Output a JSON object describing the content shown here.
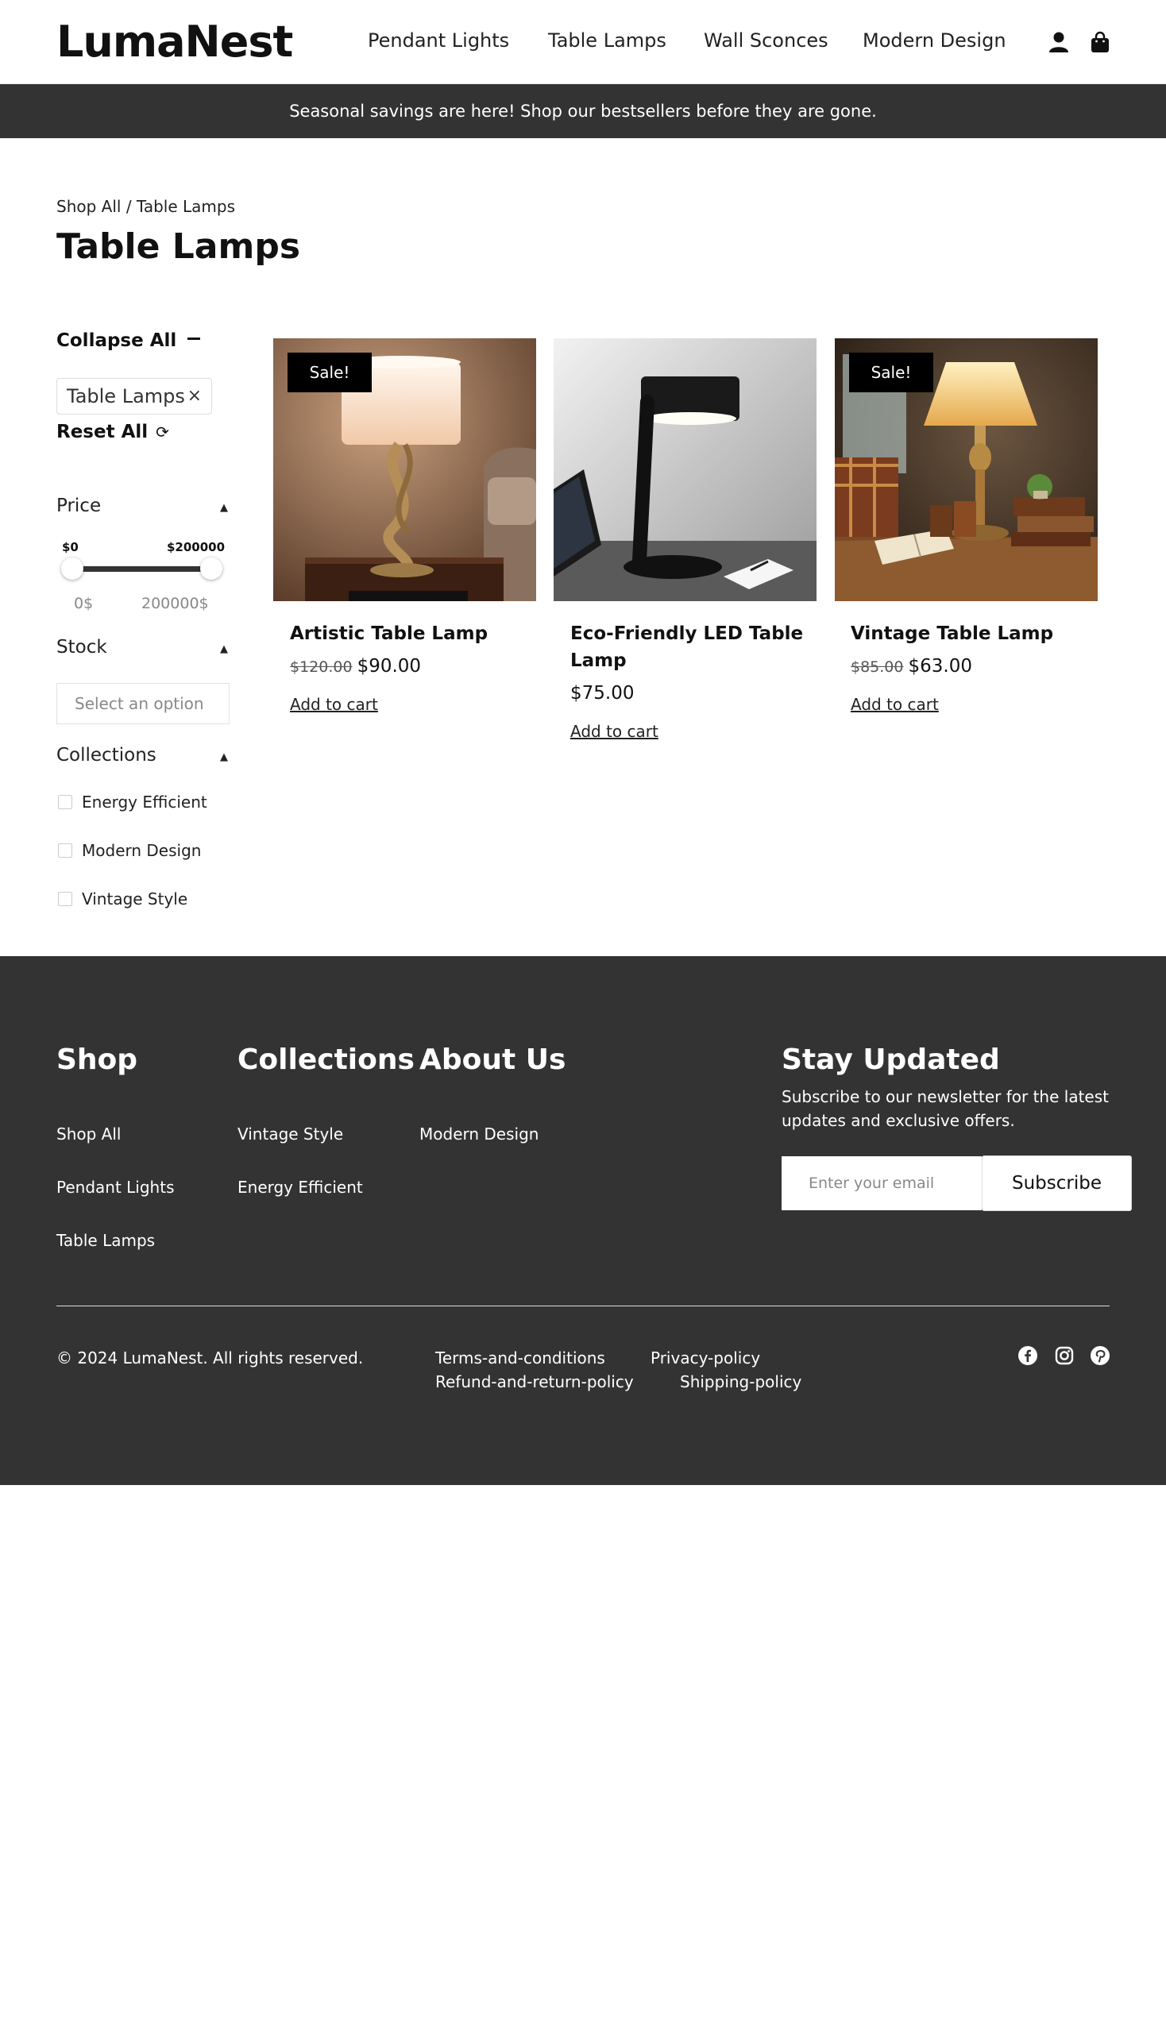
{
  "header": {
    "logo": "LumaNest",
    "nav": [
      "Pendant Lights",
      "Table Lamps",
      "Wall Sconces",
      "Modern Design"
    ],
    "icons": [
      "user-icon",
      "shopping-bag-icon"
    ]
  },
  "announcement": "Seasonal savings are here! Shop our bestsellers before they are gone.",
  "breadcrumb": {
    "home": "Shop All",
    "separator": " / ",
    "current": "Table Lamps"
  },
  "page_title": "Table Lamps",
  "sidebar": {
    "collapse_all": "Collapse All",
    "active_filter": "Table Lamps",
    "active_filter_remove": "×",
    "reset_all": "Reset All",
    "reset_icon": "⟳",
    "price": {
      "label": "Price",
      "min_label": "$0",
      "max_label": "$200000",
      "range_min": "0$",
      "range_max": "200000$",
      "min_value": 0,
      "max_value": 200000
    },
    "stock": {
      "label": "Stock",
      "placeholder": "Select an option"
    },
    "collections": {
      "label": "Collections",
      "options": [
        "Energy Efficient",
        "Modern Design",
        "Vintage Style"
      ]
    }
  },
  "products": [
    {
      "name": "Artistic Table Lamp",
      "sale_badge": "Sale!",
      "old_price": "$120.00",
      "price": "$90.00",
      "cta": "Add to cart"
    },
    {
      "name": "Eco-Friendly LED Table Lamp",
      "sale_badge": "",
      "old_price": "",
      "price": "$75.00",
      "cta": "Add to cart"
    },
    {
      "name": "Vintage Table Lamp",
      "sale_badge": "Sale!",
      "old_price": "$85.00",
      "price": "$63.00",
      "cta": "Add to cart"
    }
  ],
  "footer": {
    "shop": {
      "heading": "Shop",
      "links": [
        "Shop All",
        "Pendant Lights",
        "Table Lamps"
      ]
    },
    "collections": {
      "heading": "Collections",
      "links": [
        "Vintage Style",
        "Energy Efficient"
      ]
    },
    "about": {
      "heading": "About Us",
      "links": [
        "Modern Design"
      ]
    },
    "newsletter": {
      "heading": "Stay Updated",
      "text": "Subscribe to our newsletter for the latest updates and exclusive offers.",
      "placeholder": "Enter your email",
      "button": "Subscribe"
    },
    "copyright": "© 2024 LumaNest. All rights reserved.",
    "legal": [
      "Terms-and-conditions",
      "Privacy-policy",
      "Refund-and-return-policy",
      "Shipping-policy"
    ],
    "social": [
      "facebook-icon",
      "instagram-icon",
      "pinterest-icon"
    ]
  },
  "colors": {
    "dark_band": "#333333",
    "badge": "#000000",
    "text": "#111111"
  }
}
